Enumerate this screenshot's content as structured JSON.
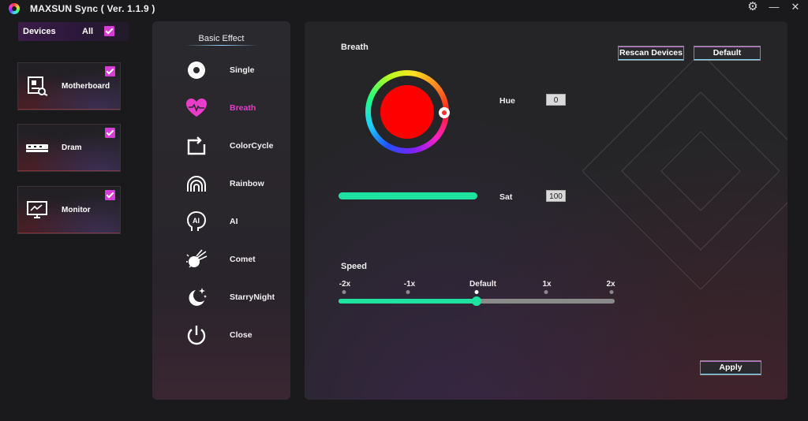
{
  "app": {
    "title": "MAXSUN Sync ( Ver. 1.1.9 )",
    "settings_glyph": "⚙",
    "minimize_glyph": "—",
    "close_glyph": "✕"
  },
  "devices": {
    "label": "Devices",
    "all_label": "All",
    "all_checked": true,
    "items": [
      {
        "label": "Motherboard",
        "icon": "motherboard-icon",
        "checked": true
      },
      {
        "label": "Dram",
        "icon": "dram-icon",
        "checked": true
      },
      {
        "label": "Monitor",
        "icon": "monitor-icon",
        "checked": true
      }
    ]
  },
  "effects": {
    "title": "Basic Effect",
    "selected": "Breath",
    "items": [
      {
        "label": "Single",
        "icon": "single-icon"
      },
      {
        "label": "Breath",
        "icon": "heart-pulse-icon"
      },
      {
        "label": "ColorCycle",
        "icon": "cycle-icon"
      },
      {
        "label": "Rainbow",
        "icon": "rainbow-icon"
      },
      {
        "label": "AI",
        "icon": "ai-head-icon"
      },
      {
        "label": "Comet",
        "icon": "comet-icon"
      },
      {
        "label": "StarryNight",
        "icon": "moon-stars-icon"
      },
      {
        "label": "Close",
        "icon": "power-icon"
      }
    ]
  },
  "main": {
    "section_title": "Breath",
    "rescan_label": "Rescan Devices",
    "default_label": "Default",
    "apply_label": "Apply",
    "hue_label": "Hue",
    "hue_value": "0",
    "sat_label": "Sat",
    "sat_value": "100",
    "selected_color": "#ff0000",
    "speed": {
      "label": "Speed",
      "ticks": [
        "-2x",
        "-1x",
        "Default",
        "1x",
        "2x"
      ],
      "selected_index": 2
    }
  },
  "colors": {
    "accent_pink": "#e93cc8",
    "accent_green": "#1ee3a0",
    "checkbox": "#d63cd6"
  }
}
